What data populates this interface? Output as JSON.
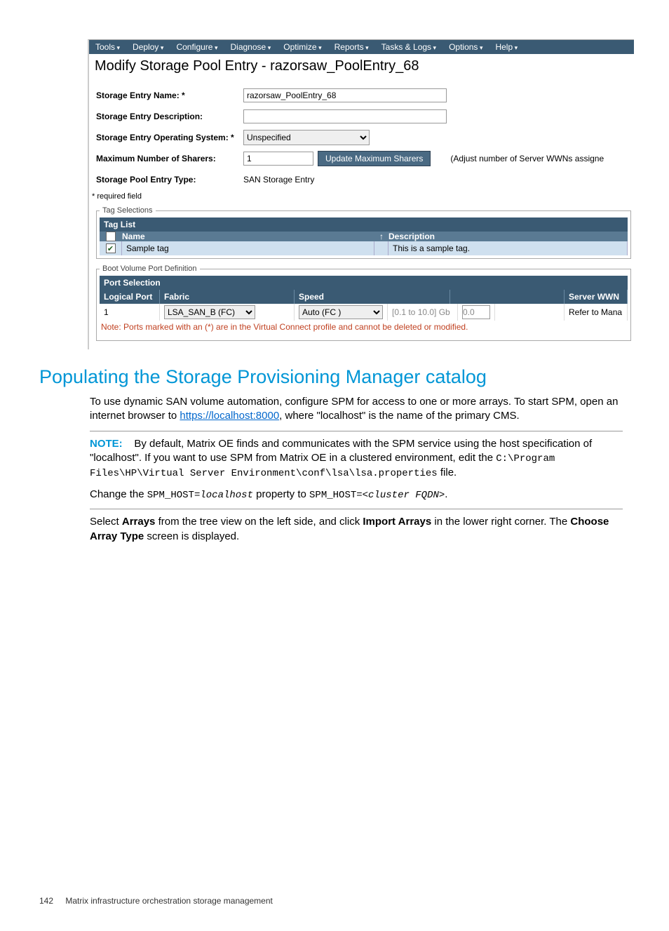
{
  "menubar": [
    "Tools",
    "Deploy",
    "Configure",
    "Diagnose",
    "Optimize",
    "Reports",
    "Tasks & Logs",
    "Options",
    "Help"
  ],
  "pageTitle": "Modify Storage Pool Entry - razorsaw_PoolEntry_68",
  "form": {
    "nameLabel": "Storage Entry Name: *",
    "nameValue": "razorsaw_PoolEntry_68",
    "descLabel": "Storage Entry Description:",
    "descValue": "",
    "osLabel": "Storage Entry Operating System: *",
    "osValue": "Unspecified",
    "sharersLabel": "Maximum Number of Sharers:",
    "sharersValue": "1",
    "updateBtn": "Update Maximum Sharers",
    "sharersHint": "(Adjust number of Server WWNs assigne",
    "typeLabel": "Storage Pool Entry Type:",
    "typeValue": "SAN Storage Entry",
    "required": "* required field"
  },
  "tags": {
    "legend": "Tag Selections",
    "title": "Tag List",
    "headers": {
      "name": "Name",
      "desc": "Description"
    },
    "row": {
      "name": "Sample tag",
      "desc": "This is a sample tag."
    }
  },
  "ports": {
    "legend": "Boot Volume Port Definition",
    "title": "Port Selection",
    "headers": {
      "lp": "Logical Port",
      "fab": "Fabric",
      "spd": "Speed",
      "srv": "Server WWN"
    },
    "row": {
      "lp": "1",
      "fab": "LSA_SAN_B (FC)",
      "spd": "Auto (FC )",
      "range": "[0.1 to 10.0] Gb",
      "gb": "0.0",
      "srv": "Refer to Mana"
    },
    "note": "Note: Ports marked with an (*) are in the Virtual Connect profile and cannot be deleted or modified."
  },
  "doc": {
    "h2": "Populating the Storage Provisioning Manager catalog",
    "p1a": "To use dynamic SAN volume automation, configure SPM for access to one or more arrays. To start SPM, open an internet browser to ",
    "p1link": "https://localhost:8000",
    "p1b": ", where \"localhost\" is the name of the primary CMS.",
    "noteLabel": "NOTE:",
    "noteText": "By default, Matrix OE finds and communicates with the SPM service using the host specification of \"localhost\". If you want to use SPM from Matrix OE in a clustered environment, edit the ",
    "notePath": "C:\\Program Files\\HP\\Virtual Server Environment\\conf\\lsa\\lsa.properties",
    "noteFile": " file.",
    "change1": "Change the ",
    "changeCode1": "SPM_HOST=",
    "changeItalic1": "localhost",
    "change2": " property to ",
    "changeCode2": "SPM_HOST=",
    "changeItalic2": "<cluster FQDN>",
    "changeDot": ".",
    "p3a": "Select ",
    "p3b1": "Arrays",
    "p3c": " from the tree view on the left side, and click ",
    "p3b2": "Import Arrays",
    "p3d": " in the lower right corner. The ",
    "p3b3": "Choose Array Type",
    "p3e": " screen is displayed."
  },
  "footer": {
    "page": "142",
    "chapter": "Matrix infrastructure orchestration storage management"
  }
}
